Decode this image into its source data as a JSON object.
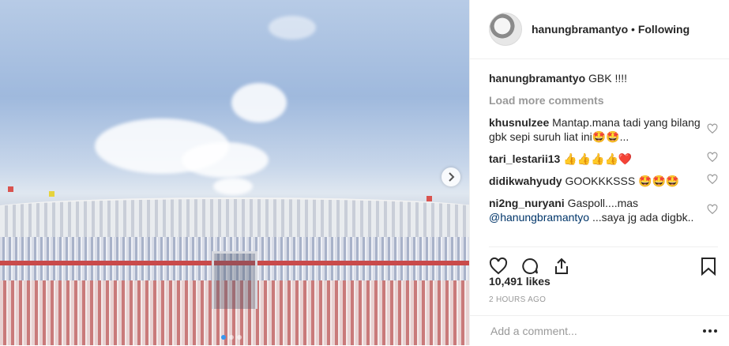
{
  "post": {
    "username": "hanungbramantyo",
    "separator": "•",
    "follow_status": "Following",
    "caption_user": "hanungbramantyo",
    "caption_text": "GBK !!!!",
    "load_more": "Load more comments",
    "comments": [
      {
        "user": "khusnulzee",
        "text": "Mantap.mana tadi yang bilang gbk sepi suruh liat ini🤩🤩..."
      },
      {
        "user": "tari_lestarii13",
        "text": "👍👍👍👍❤️"
      },
      {
        "user": "didikwahyudy",
        "text": "GOOKKKSSS 🤩🤩🤩"
      },
      {
        "user": "ni2ng_nuryani",
        "text": "Gaspoll....mas",
        "mention": "@hanungbramantyo",
        "text2": "...saya jg ada digbk.."
      }
    ],
    "likes": "10,491 likes",
    "timestamp": "2 HOURS AGO",
    "add_comment_placeholder": "Add a comment..."
  },
  "icons": {
    "like": "heart-icon",
    "comment": "comment-icon",
    "share": "share-icon",
    "save": "bookmark-icon",
    "more": "more-options-icon",
    "next": "chevron-right-icon"
  },
  "carousel": {
    "count": 3,
    "active_index": 0
  },
  "colors": {
    "accent": "#3897f0",
    "muted": "#999999",
    "text": "#262626"
  }
}
